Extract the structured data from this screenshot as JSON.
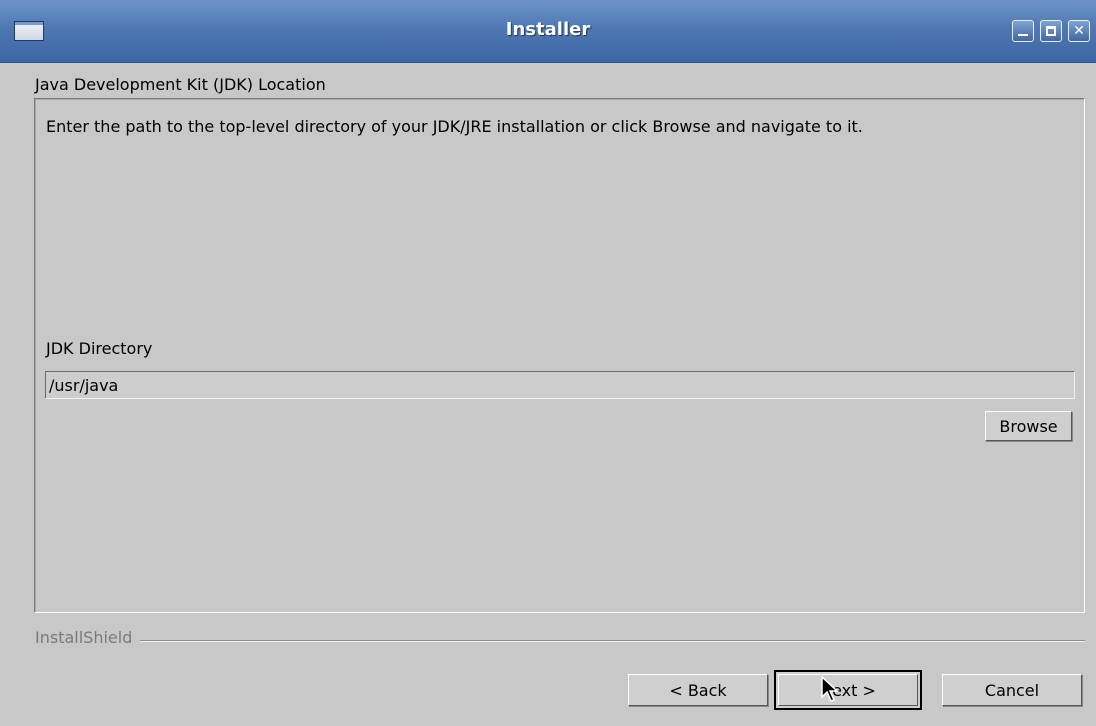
{
  "window": {
    "title": "Installer",
    "app_icon": "window-icon",
    "controls": {
      "minimize": "minimize-icon",
      "maximize": "maximize-icon",
      "close": "close-icon"
    }
  },
  "page": {
    "heading": "Java Development Kit (JDK) Location",
    "description": "Enter the path to the top-level directory of your JDK/JRE installation or click Browse and navigate to it.",
    "directory_label": "JDK Directory",
    "directory_value": "/usr/java",
    "browse_label": "Browse"
  },
  "footer": {
    "brand": "InstallShield",
    "back_label": "< Back",
    "next_label": "Next >",
    "cancel_label": "Cancel"
  },
  "colors": {
    "titlebar": "#4f78b3",
    "background": "#c8c8c8",
    "brand_text": "#7a7a7a"
  }
}
